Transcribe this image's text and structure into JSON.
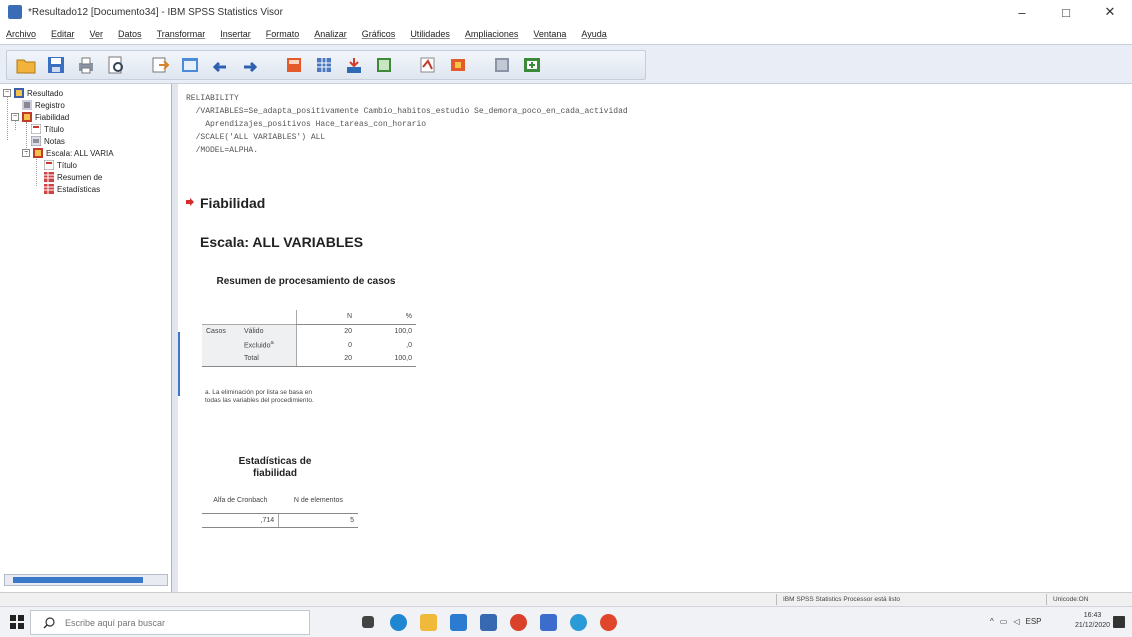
{
  "window": {
    "title": "*Resultado12 [Documento34] - IBM SPSS Statistics Visor",
    "controls": [
      "–",
      "□",
      "✕"
    ]
  },
  "menu": [
    "Archivo",
    "Editar",
    "Ver",
    "Datos",
    "Transformar",
    "Insertar",
    "Formato",
    "Analizar",
    "Gráficos",
    "Utilidades",
    "Ampliaciones",
    "Ventana",
    "Ayuda"
  ],
  "toolbar": {
    "icons": [
      "open-icon",
      "save-icon",
      "print-icon",
      "print-preview-icon",
      "export-icon",
      "recall-dialog-icon",
      "undo-icon",
      "redo-icon",
      "goto-data-icon",
      "goto-case-icon",
      "variables-icon",
      "insert-output-icon",
      "insert-heading-icon",
      "insert-title-icon",
      "show-all-icon",
      "designate-window-icon"
    ]
  },
  "navigator": {
    "items": [
      {
        "label": "Resultado",
        "icon": "output-book-icon"
      },
      {
        "label": "Registro",
        "icon": "log-icon"
      },
      {
        "label": "Fiabilidad",
        "icon": "procedure-book-icon"
      },
      {
        "label": "Título",
        "icon": "title-icon"
      },
      {
        "label": "Notas",
        "icon": "notes-icon"
      },
      {
        "label": "Escala: ALL VARIA",
        "icon": "procedure-book-icon"
      },
      {
        "label": "Título",
        "icon": "title-icon"
      },
      {
        "label": "Resumen de",
        "icon": "table-icon"
      },
      {
        "label": "Estadísticas",
        "icon": "table-icon"
      }
    ]
  },
  "syntax": {
    "lines": [
      "RELIABILITY",
      "  /VARIABLES=Se_adapta_positivamente Cambio_habitos_estudio Se_demora_poco_en_cada_actividad",
      "    Aprendizajes_positivos Hace_tareas_con_horario",
      "  /SCALE('ALL VARIABLES') ALL",
      "  /MODEL=ALPHA."
    ]
  },
  "output": {
    "heading": "Fiabilidad",
    "scale_heading": "Escala: ALL VARIABLES",
    "case_summary": {
      "title": "Resumen de procesamiento de casos",
      "col_headers": [
        "N",
        "%"
      ],
      "group_label": "Casos",
      "rows": [
        {
          "label": "Válido",
          "n": "20",
          "pct": "100,0"
        },
        {
          "label": "Excluido",
          "sup": "a",
          "n": "0",
          "pct": ",0"
        },
        {
          "label": "Total",
          "n": "20",
          "pct": "100,0"
        }
      ],
      "footnote": "a. La eliminación por lista se basa en todas las variables del procedimiento."
    },
    "reliability": {
      "title": "Estadísticas de fiabilidad",
      "col_headers": [
        "Alfa de Cronbach",
        "N de elementos"
      ],
      "values": [
        ",714",
        "5"
      ]
    }
  },
  "statusbar": {
    "processor": "IBM SPSS Statistics Processor está listo",
    "encoding": "Unicode:ON"
  },
  "taskbar": {
    "search_placeholder": "Escribe aquí para buscar",
    "tray_lang": "ESP",
    "time": "16:43",
    "date": "21/12/2020"
  },
  "colors": {
    "accent": "#3a78c8",
    "toolbar_bg": "#e9eef6",
    "arrow_red": "#d62b2b"
  }
}
